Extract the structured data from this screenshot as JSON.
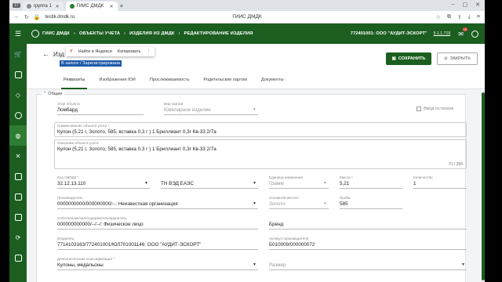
{
  "browser": {
    "tabs": [
      {
        "label": "группа 1",
        "count": "17"
      },
      {
        "label": "ГИИС ДМДК"
      }
    ],
    "new_tab": "+",
    "url": "testlk.dmdk.ru",
    "page_title": "ГИИС ДМДК"
  },
  "header": {
    "breadcrumbs": [
      "ГИИС ДМДК",
      "ОБЪЕКТЫ УЧЕТА",
      "ИЗДЕЛИЯ ИЗ ДМДК",
      "РЕДАКТИРОВАНИЕ ИЗДЕЛИЯ"
    ],
    "separator": "›",
    "org": "772401001: ООО \"АУДИТ-ЭСКОРТ\"",
    "version": "5.1.1.719",
    "mail_badge": "10"
  },
  "page": {
    "title": "Изд",
    "status_selected": "В залоге / Зарегистрирована",
    "context_popup": {
      "yandex": "Y",
      "find": "Найти в Яндексе",
      "copy": "Копировать",
      "more": "⋮"
    },
    "save_label": "СОХРАНИТЬ",
    "close_label": "ЗАКРЫТЬ"
  },
  "tabs": [
    "Реквизиты",
    "Изображения ЮИ",
    "Прослеживаемость",
    "Родительские партии",
    "Документы"
  ],
  "section_title": "Общие",
  "fields": {
    "stage": {
      "label": "Этап объекта",
      "value": "Ломбард"
    },
    "batch_type": {
      "label": "Вид партии",
      "value": "Ювелирное изделие"
    },
    "input_balance": {
      "label": "Ввод остатков"
    },
    "name": {
      "label": "Наименование объекта учета *",
      "value": "Кулон (5,21 г, Золото, 585, вставка 0,3 г ) 1 Бриллиант 0,3г Кв-33 2/7а"
    },
    "description": {
      "label": "Описание объекта учета",
      "value": "Кулон (5,21 г, Золото, 585, вставка 0,3 г ) 1 Бриллиант 0,3г Кв-33 2/7а",
      "counter": "71 / 255"
    },
    "okpd2": {
      "label": "Код ОКПД2 *",
      "value": "32.12.13.110"
    },
    "tnved": {
      "label": "",
      "value": "ТН ВЭД ЕАЭС"
    },
    "unit": {
      "label": "Единица измерения",
      "value": "Грамм"
    },
    "mass": {
      "label": "Масса *",
      "value": "5,21"
    },
    "quantity": {
      "label": "Количество",
      "value": "1"
    },
    "producer": {
      "label": "Производитель",
      "value": "0000000000/000000000/--: Неизвестная организация"
    },
    "metal": {
      "label": "Основной металл",
      "value": "Золото"
    },
    "assay": {
      "label": "Проба",
      "value": "585"
    },
    "owner": {
      "label": "Собственник/залогодержатель/хранитель",
      "value": "000000000000/--/--/: Физическое лицо"
    },
    "brand": {
      "label": "",
      "value": "Бренд"
    },
    "holder": {
      "label": "Владелец",
      "value": "7714103163/772401001/ЮЛ701001146: ООО \"АУДИТ-ЭСКОРТ\""
    },
    "article": {
      "label": "Артикул производителя",
      "value": "Б010009/000000072"
    },
    "classification": {
      "label": "Дополнительная классификация *",
      "value": "Кулоны, медальоны"
    },
    "size": {
      "label": "",
      "value": "Размер"
    }
  }
}
